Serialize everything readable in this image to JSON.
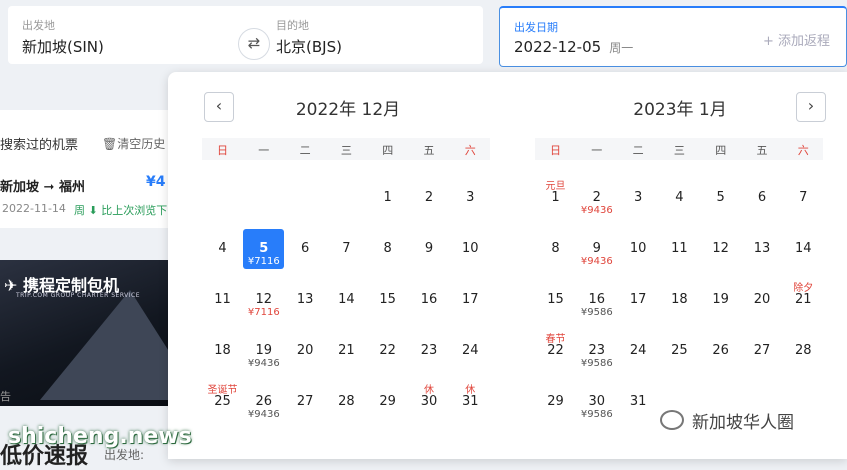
{
  "search": {
    "from_label": "出发地",
    "from_value": "新加坡(SIN)",
    "to_label": "目的地",
    "to_value": "北京(BJS)",
    "date_label": "出发日期",
    "date_value": "2022-12-05",
    "date_weekday": "周一",
    "add_return": "+ 添加返程",
    "swap_icon": "⇄"
  },
  "history": {
    "title": "搜索过的机票",
    "clear": "🗑清空历史",
    "route": "新加坡 ➞ 福州",
    "price": "¥4",
    "date": "2022-11-14",
    "drop_text": "周 ⬇ 比上次浏览下降"
  },
  "banner": {
    "logo": "✈ 携程定制包机",
    "sub": "TRIP.COM GROUP CHARTER SERVICE",
    "tail": "告"
  },
  "bottom": {
    "text": "低价速报",
    "label": "出发地:"
  },
  "calendar": {
    "prev_icon": "‹",
    "next_icon": "›",
    "weekdays": [
      "日",
      "一",
      "二",
      "三",
      "四",
      "五",
      "六"
    ],
    "months": [
      {
        "title": "2022年 12月",
        "weeks": [
          [
            {
              "d": ""
            },
            {
              "d": ""
            },
            {
              "d": ""
            },
            {
              "d": ""
            },
            {
              "d": "1"
            },
            {
              "d": "2"
            },
            {
              "d": "3"
            }
          ],
          [
            {
              "d": "4"
            },
            {
              "d": "5",
              "price": "¥7116",
              "sel": true
            },
            {
              "d": "6"
            },
            {
              "d": "7"
            },
            {
              "d": "8"
            },
            {
              "d": "9"
            },
            {
              "d": "10"
            }
          ],
          [
            {
              "d": "11"
            },
            {
              "d": "12",
              "price": "¥7116",
              "red": true
            },
            {
              "d": "13"
            },
            {
              "d": "14"
            },
            {
              "d": "15"
            },
            {
              "d": "16"
            },
            {
              "d": "17"
            }
          ],
          [
            {
              "d": "18"
            },
            {
              "d": "19",
              "price": "¥9436"
            },
            {
              "d": "20"
            },
            {
              "d": "21"
            },
            {
              "d": "22"
            },
            {
              "d": "23"
            },
            {
              "d": "24"
            }
          ],
          [
            {
              "d": "25",
              "fest": "圣诞节"
            },
            {
              "d": "26",
              "price": "¥9436"
            },
            {
              "d": "27"
            },
            {
              "d": "28"
            },
            {
              "d": "29"
            },
            {
              "d": "30",
              "fest": "休"
            },
            {
              "d": "31",
              "fest": "休"
            }
          ]
        ]
      },
      {
        "title": "2023年 1月",
        "weeks": [
          [
            {
              "d": "1",
              "fest": "元旦"
            },
            {
              "d": "2",
              "price": "¥9436",
              "red": true
            },
            {
              "d": "3"
            },
            {
              "d": "4"
            },
            {
              "d": "5"
            },
            {
              "d": "6"
            },
            {
              "d": "7"
            }
          ],
          [
            {
              "d": "8"
            },
            {
              "d": "9",
              "price": "¥9436",
              "red": true
            },
            {
              "d": "10"
            },
            {
              "d": "11"
            },
            {
              "d": "12"
            },
            {
              "d": "13"
            },
            {
              "d": "14"
            }
          ],
          [
            {
              "d": "15"
            },
            {
              "d": "16",
              "price": "¥9586"
            },
            {
              "d": "17"
            },
            {
              "d": "18"
            },
            {
              "d": "19"
            },
            {
              "d": "20"
            },
            {
              "d": "21",
              "fest": "除夕"
            }
          ],
          [
            {
              "d": "22",
              "fest": "春节"
            },
            {
              "d": "23",
              "price": "¥9586"
            },
            {
              "d": "24"
            },
            {
              "d": "25"
            },
            {
              "d": "26"
            },
            {
              "d": "27"
            },
            {
              "d": "28"
            }
          ],
          [
            {
              "d": "29"
            },
            {
              "d": "30",
              "price": "¥9586"
            },
            {
              "d": "31"
            },
            {
              "d": ""
            },
            {
              "d": ""
            },
            {
              "d": ""
            },
            {
              "d": ""
            }
          ]
        ]
      }
    ]
  },
  "watermark": {
    "left": "shicheng.news",
    "right": "新加坡华人圈"
  }
}
